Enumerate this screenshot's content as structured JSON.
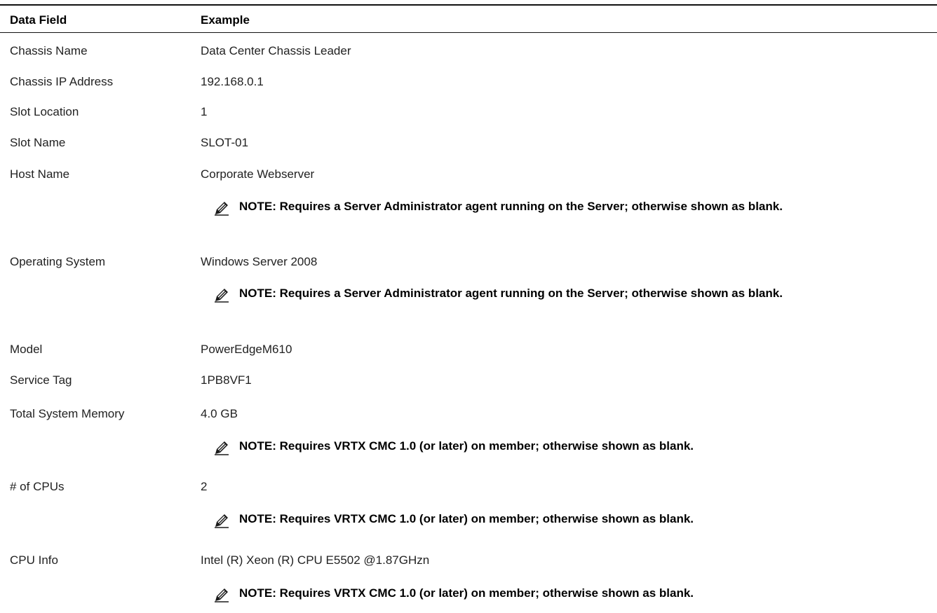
{
  "table": {
    "headers": {
      "field": "Data Field",
      "example": "Example"
    },
    "rows": [
      {
        "field": "Chassis Name",
        "value": "Data Center Chassis Leader"
      },
      {
        "field": "Chassis IP Address",
        "value": "192.168.0.1"
      },
      {
        "field": "Slot Location",
        "value": "1"
      },
      {
        "field": "Slot Name",
        "value": "SLOT-01"
      },
      {
        "field": "Host Name",
        "value": "Corporate Webserver"
      },
      {
        "field": "Operating System",
        "value": "Windows Server 2008"
      },
      {
        "field": "Model",
        "value": "PowerEdgeM610"
      },
      {
        "field": "Service Tag",
        "value": "1PB8VF1"
      },
      {
        "field": "Total System Memory",
        "value": "4.0 GB"
      },
      {
        "field": "# of CPUs",
        "value": "2"
      },
      {
        "field": "CPU Info",
        "value": "Intel (R) Xeon (R) CPU E5502 @1.87GHzn"
      }
    ],
    "notes": {
      "host_name": "NOTE: Requires a Server Administrator agent running on the Server; otherwise shown as blank.",
      "operating_system": "NOTE: Requires a Server Administrator agent running on the Server; otherwise shown as blank.",
      "total_system_memory": "NOTE: Requires VRTX CMC 1.0 (or later) on member; otherwise shown as blank.",
      "num_cpus": "NOTE: Requires VRTX CMC 1.0 (or later) on member; otherwise shown as blank.",
      "cpu_info": "NOTE: Requires VRTX CMC 1.0 (or later) on member; otherwise shown as blank."
    }
  },
  "icons": {
    "note_icon": "pencil-note-icon"
  }
}
